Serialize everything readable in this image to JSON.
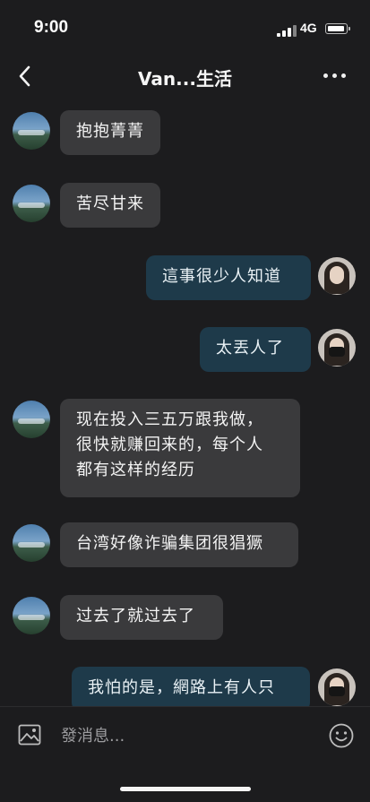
{
  "status_bar": {
    "time": "9:00",
    "network": "4G"
  },
  "nav": {
    "back_icon": "chevron-left-icon",
    "title": "Van...生活",
    "more_icon": "ellipsis-icon"
  },
  "messages": [
    {
      "direction": "incoming",
      "avatar": "landscape-avatar",
      "text": "抱抱菁菁"
    },
    {
      "direction": "incoming",
      "avatar": "landscape-avatar",
      "text": "苦尽甘来"
    },
    {
      "direction": "outgoing",
      "avatar": "person-avatar",
      "text": "這事很少人知道"
    },
    {
      "direction": "outgoing",
      "avatar": "person-avatar",
      "text": "太丟人了"
    },
    {
      "direction": "incoming",
      "avatar": "landscape-avatar",
      "text": "现在投入三五万跟我做，\n很快就赚回来的，每个人\n都有这样的经历"
    },
    {
      "direction": "incoming",
      "avatar": "landscape-avatar",
      "text": "台湾好像诈骗集团很猖獗"
    },
    {
      "direction": "incoming",
      "avatar": "landscape-avatar",
      "text": "过去了就过去了"
    },
    {
      "direction": "outgoing",
      "avatar": "person-avatar",
      "text": "我怕的是，網路上有人只"
    }
  ],
  "input_bar": {
    "image_icon": "image-icon",
    "placeholder": "發消息...",
    "emoji_icon": "smiley-icon"
  },
  "colors": {
    "background": "#1c1c1e",
    "incoming_bubble": "#3a3a3c",
    "outgoing_bubble": "#1e3a4a",
    "text": "#f4f4f4"
  }
}
